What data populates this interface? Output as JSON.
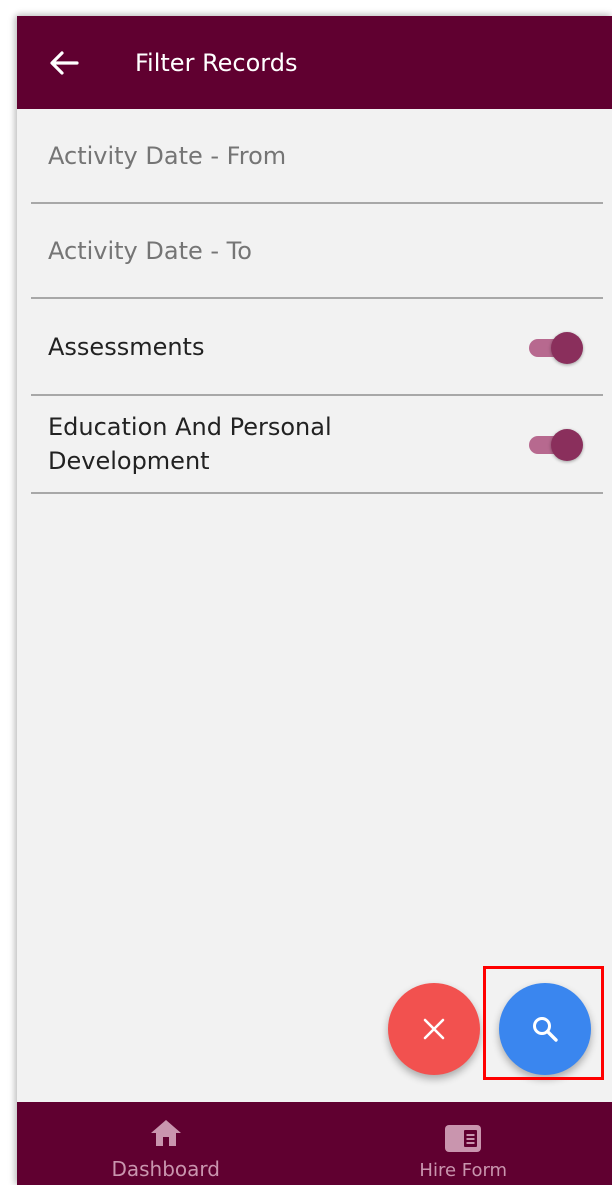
{
  "appbar": {
    "title": "Filter Records",
    "back_icon": "arrow-left-icon"
  },
  "filters": {
    "date_from_placeholder": "Activity Date - From",
    "date_to_placeholder": "Activity Date - To",
    "toggles": [
      {
        "label": "Assessments",
        "on": true
      },
      {
        "label_line1": "Education And Personal",
        "label_line2": "Development",
        "on": true
      }
    ]
  },
  "actions": {
    "cancel_icon": "close-icon",
    "search_icon": "search-icon"
  },
  "bottom_nav": [
    {
      "label": "Dashboard",
      "icon": "home-icon"
    },
    {
      "label": "Hire Form",
      "icon": "form-icon"
    }
  ],
  "colors": {
    "primary": "#600030",
    "background": "#f2f2f2",
    "toggle_thumb": "#8a2f5c",
    "toggle_track": "#b7698f",
    "cancel_fab": "#f2514f",
    "search_fab": "#3a86ef",
    "highlight": "#ff0000"
  }
}
